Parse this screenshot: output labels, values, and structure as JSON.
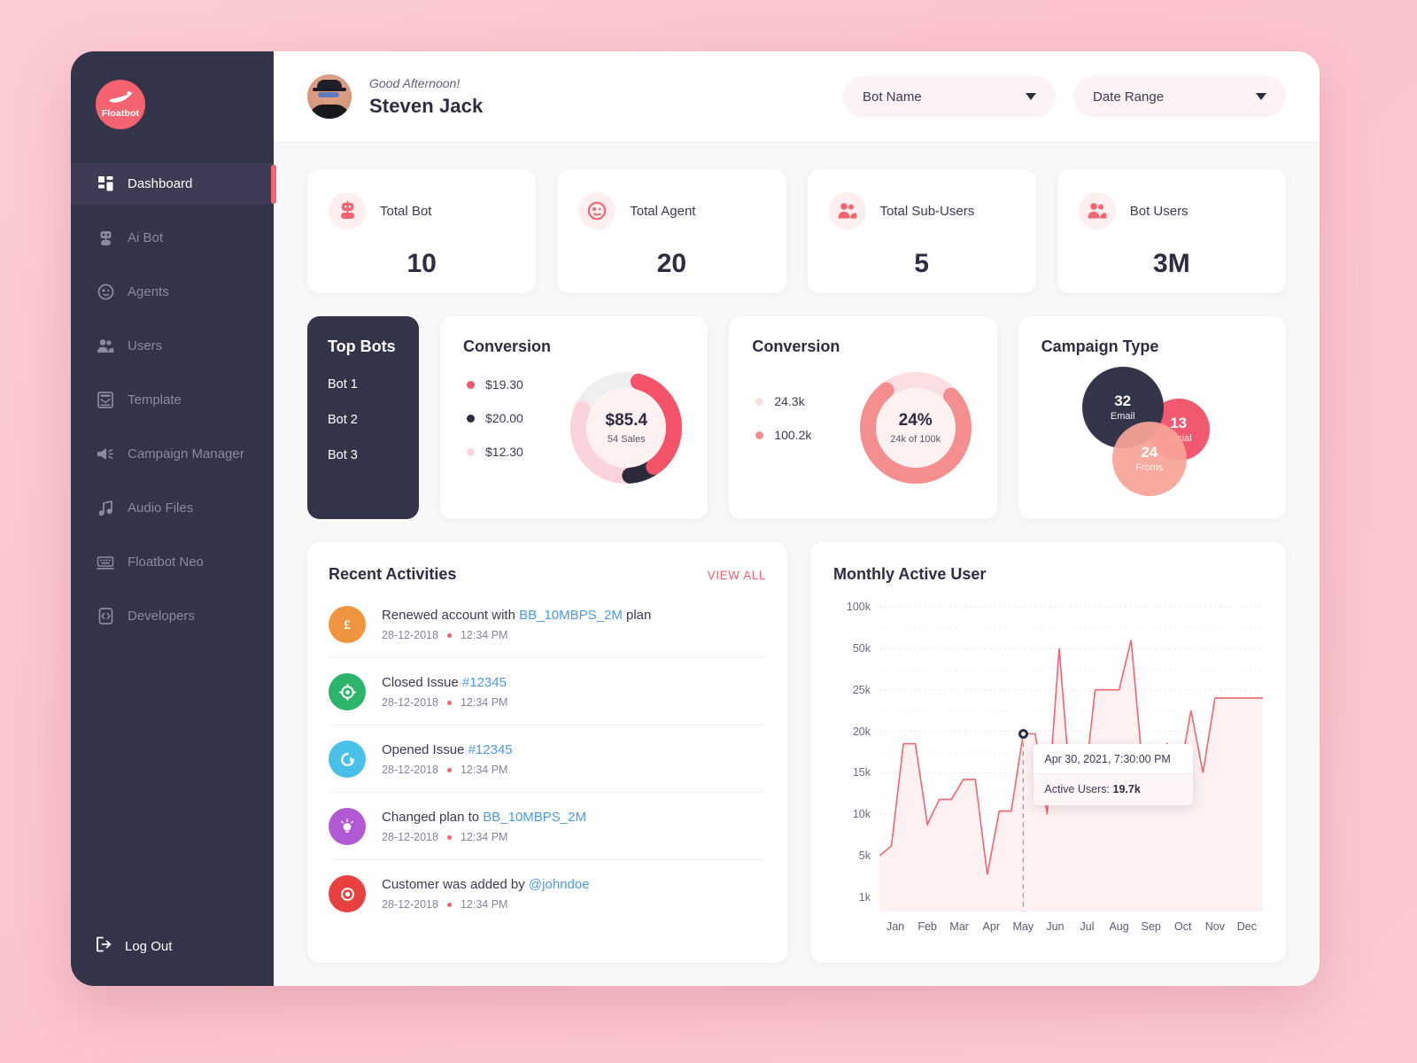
{
  "brand": {
    "name": "Floatbot",
    "logo_icon": "bird-icon",
    "accent": "#f4636f",
    "dark": "#333349"
  },
  "sidebar": {
    "items": [
      {
        "label": "Dashboard",
        "icon": "grid-icon",
        "active": true
      },
      {
        "label": "Ai Bot",
        "icon": "robot-icon",
        "active": false
      },
      {
        "label": "Agents",
        "icon": "agent-face-icon",
        "active": false
      },
      {
        "label": "Users",
        "icon": "users-icon",
        "active": false
      },
      {
        "label": "Template",
        "icon": "template-icon",
        "active": false
      },
      {
        "label": "Campaign Manager",
        "icon": "megaphone-icon",
        "active": false
      },
      {
        "label": "Audio Files",
        "icon": "music-note-icon",
        "active": false
      },
      {
        "label": "Floatbot Neo",
        "icon": "keyboard-icon",
        "active": false
      },
      {
        "label": "Developers",
        "icon": "code-brackets-icon",
        "active": false
      }
    ],
    "logout": {
      "label": "Log Out",
      "icon": "logout-icon"
    }
  },
  "topbar": {
    "greeting": "Good Afternoon!",
    "user_name": "Steven Jack",
    "avatar_icon": "user-avatar",
    "filters": [
      {
        "label": "Bot Name",
        "icon": "chevron-down-icon"
      },
      {
        "label": "Date Range",
        "icon": "chevron-down-icon"
      }
    ]
  },
  "stats": [
    {
      "label": "Total Bot",
      "value": "10",
      "icon": "robot-icon"
    },
    {
      "label": "Total Agent",
      "value": "20",
      "icon": "agent-face-icon"
    },
    {
      "label": "Total Sub-Users",
      "value": "5",
      "icon": "users-icon"
    },
    {
      "label": "Bot Users",
      "value": "3M",
      "icon": "users-icon"
    }
  ],
  "top_bots": {
    "title": "Top Bots",
    "items": [
      "Bot 1",
      "Bot 2",
      "Bot 3"
    ]
  },
  "conversion_sales": {
    "title": "Conversion",
    "center_value": "$85.4",
    "center_sub": "54 Sales",
    "legend": [
      {
        "label": "$19.30",
        "color": "#f4536a"
      },
      {
        "label": "$20.00",
        "color": "#2b2b3d"
      },
      {
        "label": "$12.30",
        "color": "#fbd3da"
      }
    ]
  },
  "conversion_rate": {
    "title": "Conversion",
    "center_value": "24%",
    "center_sub": "24k of 100k",
    "legend": [
      {
        "label": "24.3k",
        "color": "#fcdfe1"
      },
      {
        "label": "100.2k",
        "color": "#f58e8e"
      }
    ]
  },
  "campaign_type": {
    "title": "Campaign Type",
    "bubbles": [
      {
        "value": "32",
        "label": "Email",
        "color": "#333349",
        "size": 92,
        "x": 10,
        "y": 6
      },
      {
        "value": "13",
        "label": "Social",
        "color": "#f25870",
        "size": 70,
        "x": 83,
        "y": 34
      },
      {
        "value": "24",
        "label": "Froms",
        "color": "#f9a497",
        "size": 84,
        "x": 42,
        "y": 70
      }
    ]
  },
  "recent_activities": {
    "title": "Recent Activities",
    "view_all": "VIEW ALL",
    "items": [
      {
        "icon": "pound-currency-icon",
        "icon_color": "#f0953f",
        "glyph": "£",
        "text_before": "Renewed account with ",
        "link": "BB_10MBPS_2M",
        "text_after": " plan",
        "date": "28-12-2018",
        "time": "12:34 PM"
      },
      {
        "icon": "target-icon",
        "icon_color": "#2cb56a",
        "glyph": "◎",
        "text_before": "Closed Issue ",
        "link": "#12345",
        "text_after": "",
        "date": "28-12-2018",
        "time": "12:34 PM"
      },
      {
        "icon": "refresh-circle-icon",
        "icon_color": "#49c0e8",
        "glyph": "◔",
        "text_before": "Opened Issue ",
        "link": "#12345",
        "text_after": "",
        "date": "28-12-2018",
        "time": "12:34 PM"
      },
      {
        "icon": "lightbulb-icon",
        "icon_color": "#b159d4",
        "glyph": "☀",
        "text_before": "Changed plan to ",
        "link": "BB_10MBPS_2M",
        "text_after": "",
        "date": "28-12-2018",
        "time": "12:34 PM"
      },
      {
        "icon": "eye-circle-icon",
        "icon_color": "#e8413f",
        "glyph": "◉",
        "text_before": "Customer was added by ",
        "link": "@johndoe",
        "text_after": "",
        "date": "28-12-2018",
        "time": "12:34 PM"
      }
    ]
  },
  "chart_data": {
    "type": "area",
    "title": "Monthly Active User",
    "xlabel": "",
    "ylabel": "",
    "grid": true,
    "legend_position": "none",
    "line_color": "#f4636f",
    "fill_color": "#fdf1f2",
    "categories": [
      "Jan",
      "Feb",
      "Mar",
      "Apr",
      "May",
      "Jun",
      "Jul",
      "Aug",
      "Sep",
      "Oct",
      "Nov",
      "Dec"
    ],
    "ytick_labels": [
      "100k",
      "50k",
      "25k",
      "20k",
      "15k",
      "10k",
      "5k",
      "1k"
    ],
    "ytick_values": [
      100000,
      50000,
      25000,
      20000,
      15000,
      10000,
      5000,
      1000
    ],
    "x": [
      "Jan-a",
      "Jan-b",
      "Jan-c",
      "Feb-a",
      "Feb-b",
      "Feb-c",
      "Mar-a",
      "Mar-b",
      "Mar-c",
      "Apr-a",
      "Apr-b",
      "Apr-c",
      "May-a",
      "May-b",
      "May-c",
      "Jun-a",
      "Jun-b",
      "Jun-c",
      "Jul-a",
      "Jul-b",
      "Jul-c",
      "Aug-a",
      "Aug-b",
      "Aug-c",
      "Sep-a",
      "Sep-b",
      "Sep-c",
      "Oct-a",
      "Oct-b",
      "Oct-c",
      "Nov-a",
      "Nov-b",
      "Dec-a"
    ],
    "values": [
      5000,
      6200,
      18500,
      18500,
      8800,
      11800,
      11800,
      14200,
      14200,
      3200,
      10400,
      10400,
      19700,
      19700,
      10000,
      50000,
      12000,
      12000,
      25000,
      25000,
      25000,
      60000,
      15000,
      17000,
      18500,
      14500,
      22500,
      15000,
      24000,
      24000,
      24000,
      24000,
      24000
    ],
    "tooltip": {
      "timestamp": "Apr 30, 2021, 7:30:00 PM",
      "series_label": "Active Users:",
      "series_value": "19.7k"
    }
  }
}
